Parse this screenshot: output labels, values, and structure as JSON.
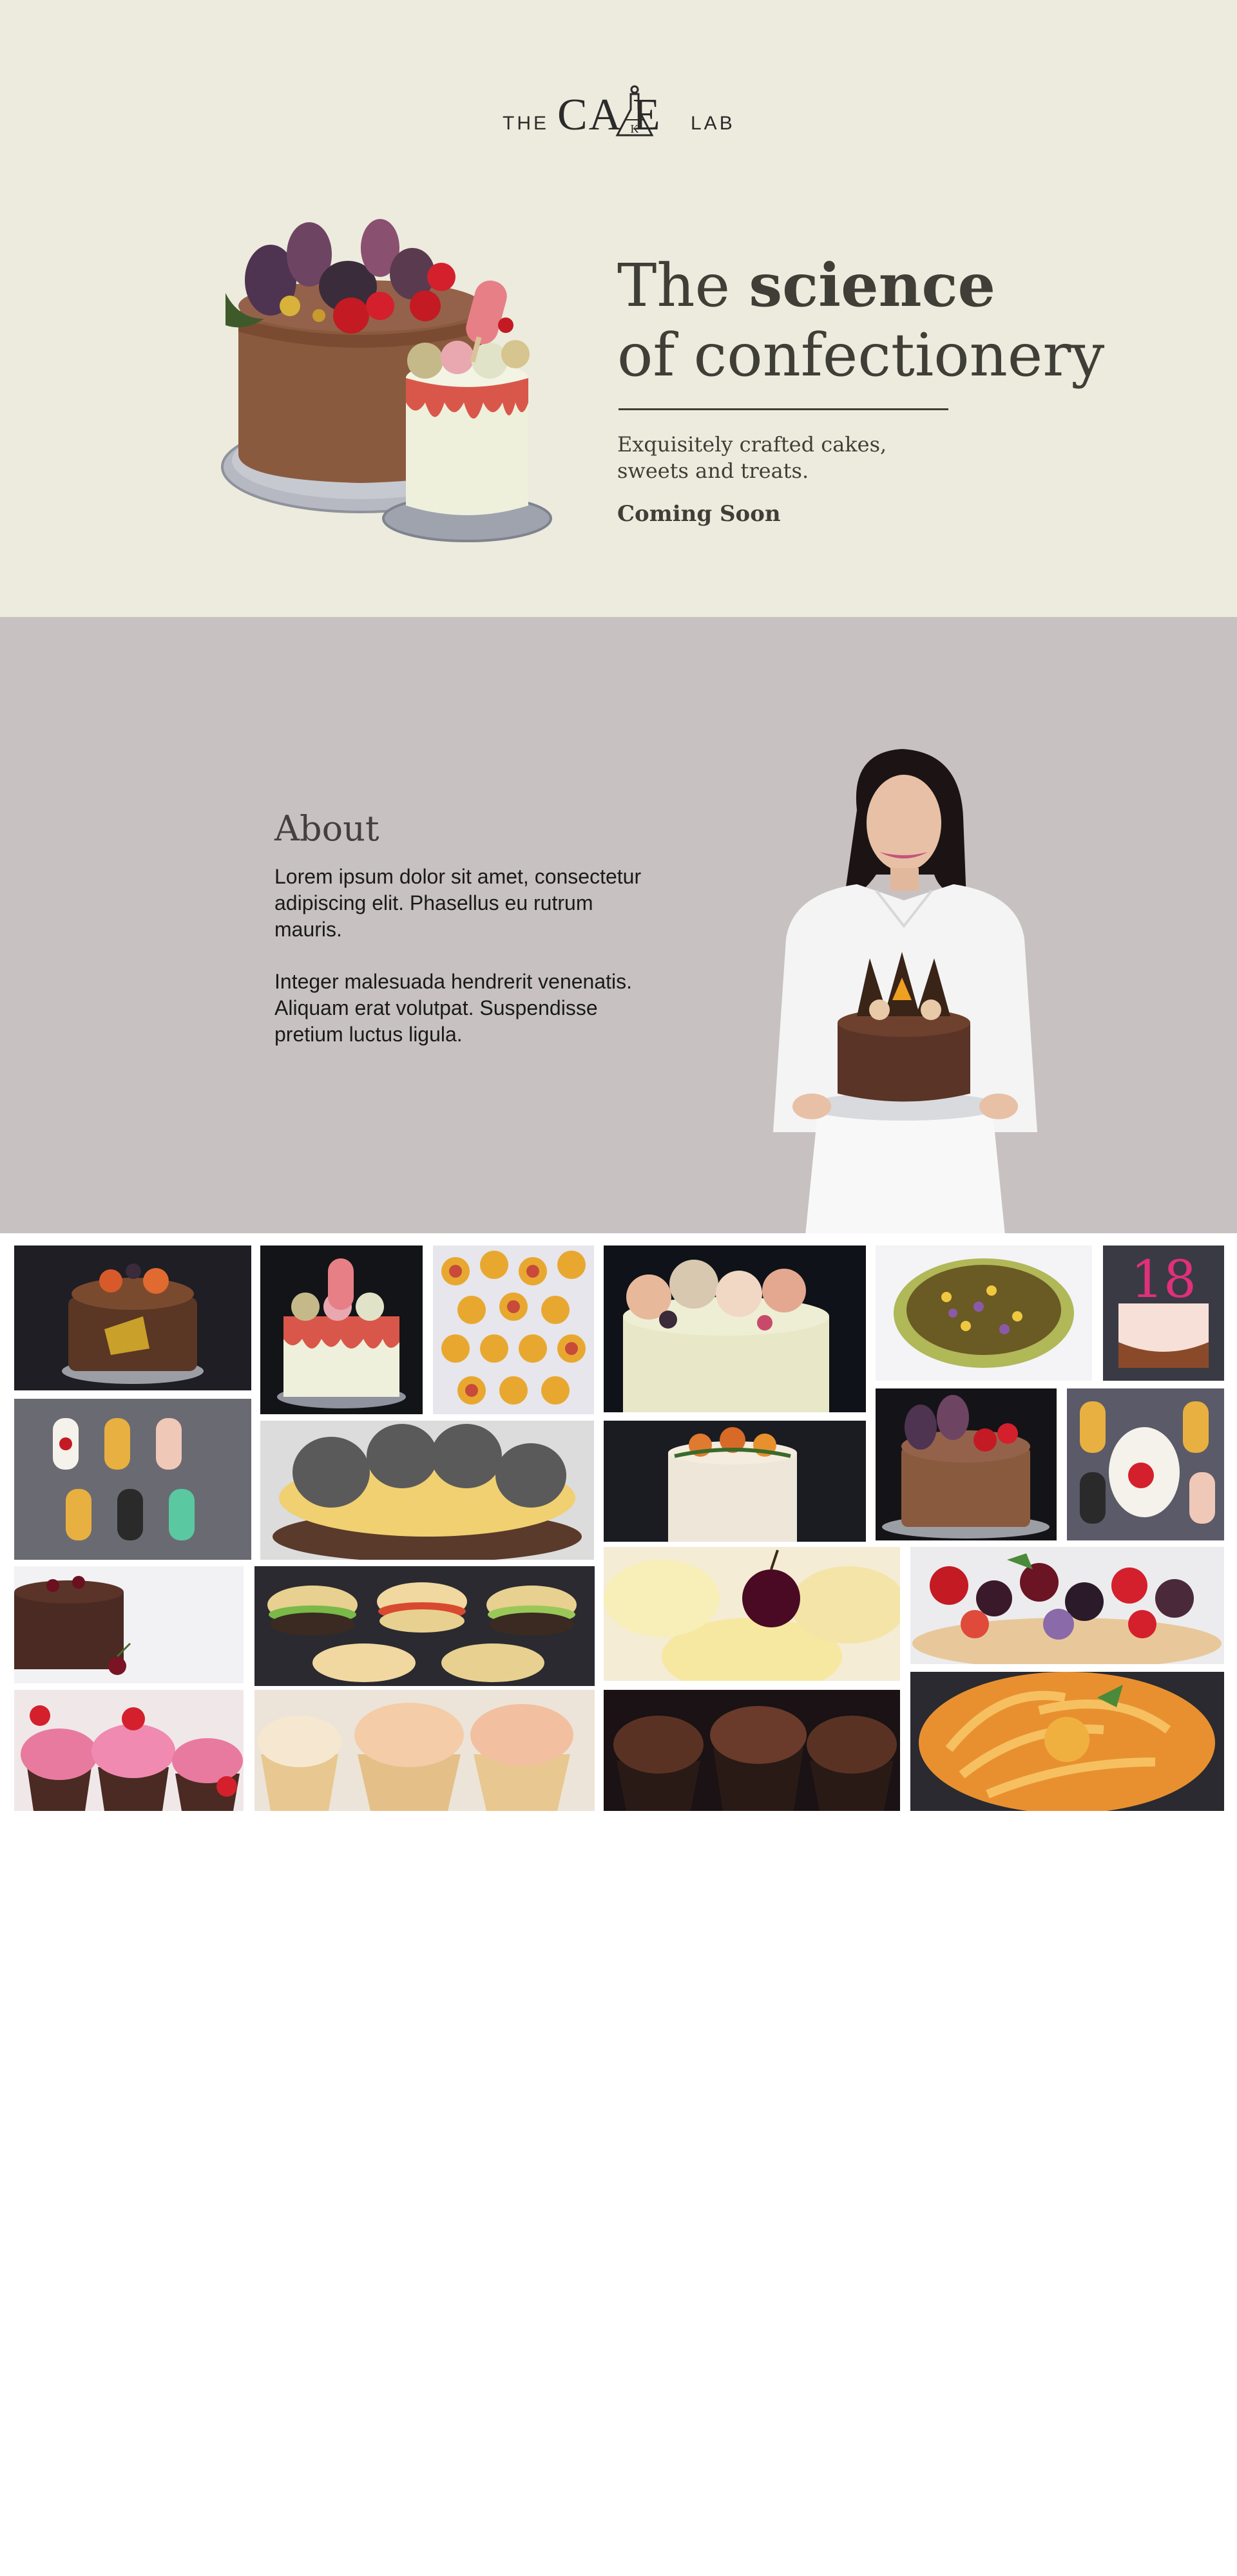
{
  "brand": {
    "logo_the": "THE",
    "logo_main": "CA E",
    "logo_k": "K",
    "logo_lab": "LAB"
  },
  "hero": {
    "title_plain": "The ",
    "title_bold": "science",
    "title_line2": "of confectionery",
    "subtitle": "Exquisitely crafted cakes, sweets and treats.",
    "status": "Coming Soon",
    "image": "chocolate-fig-cake-and-drip-cake"
  },
  "about": {
    "title": "About",
    "paragraph1": "Lorem ipsum dolor sit amet, consectetur adipiscing elit. Phasellus eu rutrum mauris.",
    "paragraph2": "Integer malesuada hendrerit venenatis. Aliquam erat volutpat. Suspendisse pretium luctus ligula.",
    "image": "chef-holding-chocolate-cake"
  },
  "gallery": [
    {
      "subject": "chocolate-orange-cake"
    },
    {
      "subject": "drip-cake-with-popsicle"
    },
    {
      "subject": "tarts-flatlay"
    },
    {
      "subject": "macaron-topped-cake"
    },
    {
      "subject": "star-tart"
    },
    {
      "subject": "number-18-cake"
    },
    {
      "subject": "cakesicles"
    },
    {
      "subject": "macaron-ring-cake"
    },
    {
      "subject": "naked-citrus-cake"
    },
    {
      "subject": "chocolate-fig-cake"
    },
    {
      "subject": "reindeer-cakepops"
    },
    {
      "subject": "cherry-chocolate-cake"
    },
    {
      "subject": "macaron-burgers"
    },
    {
      "subject": "cherry-cream-cups"
    },
    {
      "subject": "berry-tart"
    },
    {
      "subject": "raspberry-cupcakes"
    },
    {
      "subject": "pink-swirl-cupcakes"
    },
    {
      "subject": "chocolate-cupcakes"
    },
    {
      "subject": "peach-rose-tart"
    }
  ],
  "colors": {
    "hero_bg": "#ecebdd",
    "about_bg": "#c8c1c1",
    "text_dark": "#3f3e37"
  }
}
